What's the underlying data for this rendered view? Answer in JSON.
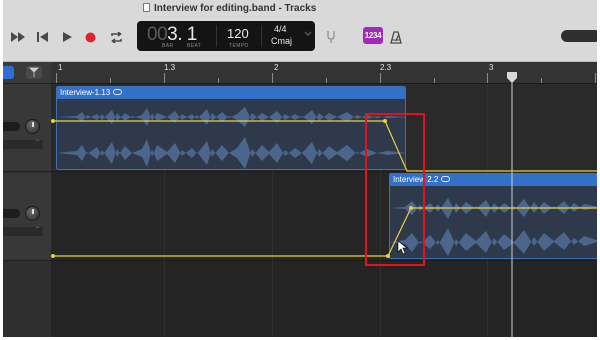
{
  "window": {
    "title": "Interview for editing.band - Tracks"
  },
  "control_bar": {
    "transport": [
      {
        "name": "fast-forward",
        "icon": "fast-forward-icon"
      },
      {
        "name": "go-to-beginning",
        "icon": "skip-back-icon"
      },
      {
        "name": "play",
        "icon": "play-icon"
      },
      {
        "name": "record",
        "icon": "record-icon"
      },
      {
        "name": "cycle",
        "icon": "cycle-icon"
      }
    ],
    "lcd": {
      "position_dim": "00",
      "position": "3. 1",
      "bar_label": "BAR",
      "beat_label": "BEAT",
      "tempo": "120",
      "tempo_label": "TEMPO",
      "time_signature": "4/4",
      "key": "Cmaj"
    },
    "count_in": "1234",
    "record_color": "#e0232a",
    "count_in_color": "#a32ab8"
  },
  "ruler": {
    "labels": [
      "1",
      "1.3",
      "2",
      "2.3",
      "3"
    ]
  },
  "tracks": [
    {
      "regions": [
        {
          "name": "Interview-1.13"
        }
      ]
    },
    {
      "regions": [
        {
          "name": "Interview 2.2"
        }
      ]
    }
  ],
  "accent_color": "#3470c6",
  "automation_color": "#e6d33a",
  "highlight_color": "#e0141a"
}
